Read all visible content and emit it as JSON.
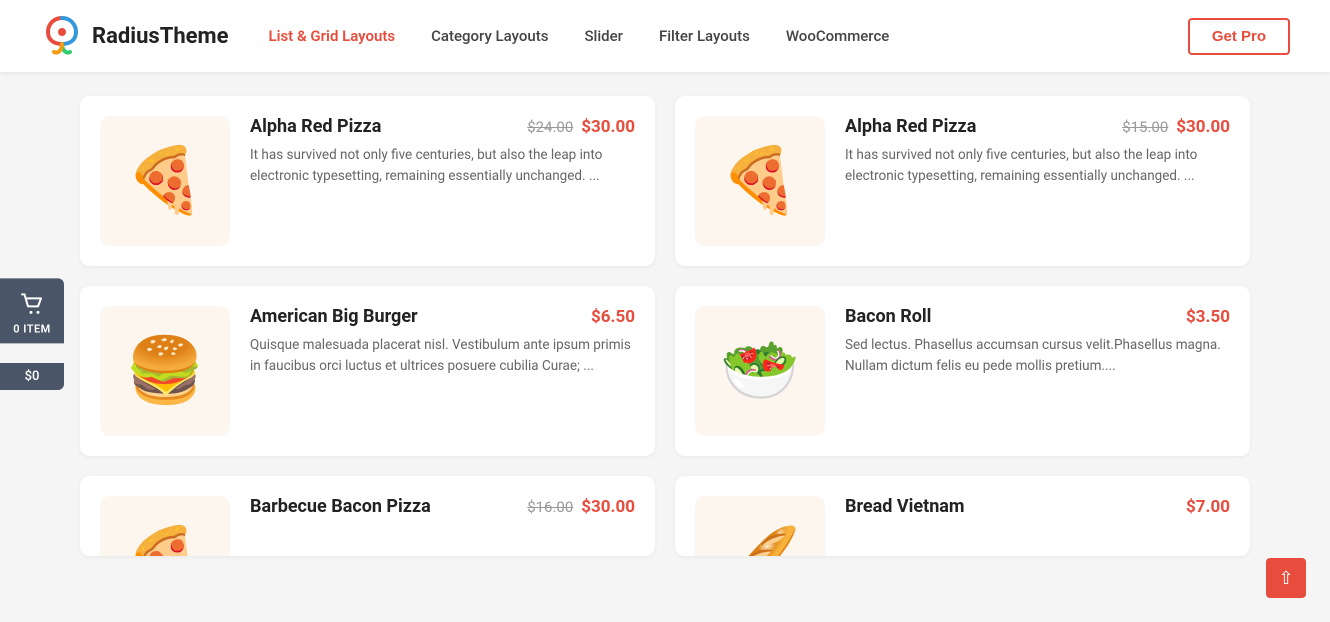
{
  "header": {
    "logo_text": "RadiusTheme",
    "nav": [
      {
        "label": "List & Grid Layouts",
        "active": true
      },
      {
        "label": "Category Layouts",
        "active": false
      },
      {
        "label": "Slider",
        "active": false
      },
      {
        "label": "Filter Layouts",
        "active": false
      },
      {
        "label": "WooCommerce",
        "active": false
      }
    ],
    "cta_label": "Get Pro"
  },
  "cart": {
    "icon_label": "cart-icon",
    "count_label": "0 ITEM",
    "price_label": "$0"
  },
  "products": [
    {
      "name": "Alpha Red Pizza",
      "price_old": "$24.00",
      "price_new": "$30.00",
      "description": "It has survived not only five centuries, but also the leap into electronic typesetting, remaining essentially unchanged. ...",
      "image_emoji": "🍕",
      "image_bg": "#fdf6ee"
    },
    {
      "name": "Alpha Red Pizza",
      "price_old": "$15.00",
      "price_new": "$30.00",
      "description": "It has survived not only five centuries, but also the leap into electronic typesetting, remaining essentially unchanged. ...",
      "image_emoji": "🍕",
      "image_bg": "#fdf6ee"
    },
    {
      "name": "American Big Burger",
      "price_old": null,
      "price_new": "$6.50",
      "description": "Quisque malesuada placerat nisl. Vestibulum ante ipsum primis in faucibus orci luctus et ultrices posuere cubilia Curae; ...",
      "image_emoji": "🍔",
      "image_bg": "#fdf6ee"
    },
    {
      "name": "Bacon Roll",
      "price_old": null,
      "price_new": "$3.50",
      "description": "Sed lectus. Phasellus accumsan cursus velit.Phasellus magna. Nullam dictum felis eu pede mollis pretium....",
      "image_emoji": "🥗",
      "image_bg": "#fdf6ee"
    },
    {
      "name": "Barbecue Bacon Pizza",
      "price_old": "$16.00",
      "price_new": "$30.00",
      "description": "",
      "image_emoji": "🍕",
      "image_bg": "#fdf6ee"
    },
    {
      "name": "Bread Vietnam",
      "price_old": null,
      "price_new": "$7.00",
      "description": "",
      "image_emoji": "🥖",
      "image_bg": "#fdf6ee"
    }
  ]
}
